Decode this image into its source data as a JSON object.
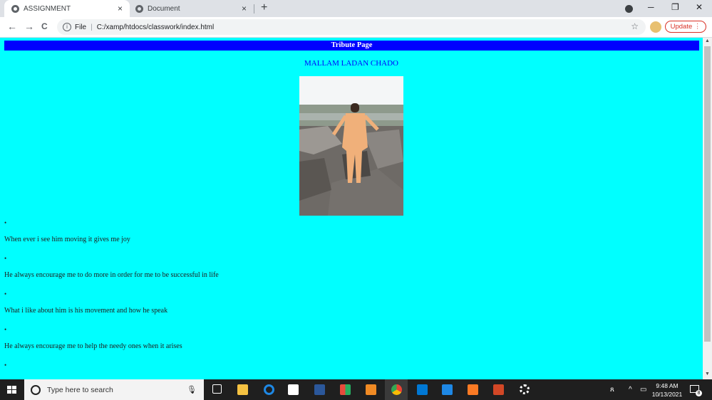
{
  "browser": {
    "tabs": [
      {
        "title": "ASSIGNMENT",
        "active": true
      },
      {
        "title": "Document",
        "active": false
      }
    ],
    "new_tab": "+",
    "close_glyph": "×",
    "controls": {
      "minimize": "─",
      "restore": "❐",
      "close": "✕"
    },
    "nav": {
      "back": "←",
      "forward": "→",
      "reload": "C"
    },
    "address": {
      "prefix": "File",
      "separator": "|",
      "url": "C:/xamp/htdocs/classwork/index.html",
      "star": "☆"
    },
    "update_label": "Update ⋮"
  },
  "page": {
    "banner": "Tribute Page",
    "heading": "MALLAM LADAN CHADO",
    "bullet_glyph": "•",
    "items": [
      "When ever i see him moving it gives me joy",
      "He always encourage me to do more in order for me to be successful in life",
      "What i like about him is his movement and how he speak",
      "He always encourage me to help the needy ones when it arises"
    ],
    "colors": {
      "background": "#00ffff",
      "banner": "#0000ff",
      "heading": "#0000ff"
    }
  },
  "taskbar": {
    "search_placeholder": "Type here to search",
    "time": "9:48 AM",
    "date": "10/13/2021",
    "notification_count": "8",
    "apps": [
      "task-view-icon",
      "file-explorer-icon",
      "edge-icon",
      "store-icon",
      "word-icon",
      "office-icon",
      "sublime-icon",
      "chrome-icon",
      "mail-icon",
      "vscode-icon",
      "xampp-icon",
      "powerpoint-icon",
      "settings-icon"
    ]
  }
}
